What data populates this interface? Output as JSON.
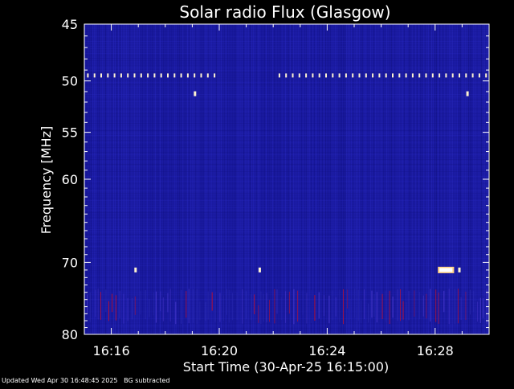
{
  "chart_data": {
    "type": "heatmap",
    "title": "Solar radio Flux (Glasgow)",
    "xlabel": "Start Time (30-Apr-25 16:15:00)",
    "ylabel": "Frequency [MHz]",
    "xlim_minutes_after_16_00": [
      15.0,
      30.0
    ],
    "ylim_mhz": [
      45,
      80
    ],
    "y_scale": "log",
    "x_ticks": [
      {
        "minute": 16,
        "label": "16:16"
      },
      {
        "minute": 20,
        "label": "16:20"
      },
      {
        "minute": 24,
        "label": "16:24"
      },
      {
        "minute": 28,
        "label": "16:28"
      }
    ],
    "y_ticks": [
      {
        "mhz": 45,
        "label": "45"
      },
      {
        "mhz": 50,
        "label": "50"
      },
      {
        "mhz": 55,
        "label": "55"
      },
      {
        "mhz": 60,
        "label": "60"
      },
      {
        "mhz": 70,
        "label": "70"
      },
      {
        "mhz": 80,
        "label": "80"
      }
    ],
    "colors": {
      "background": "#000000",
      "plot_base": "#1a1aa0",
      "interference_dots": "#fff3d0",
      "burst": "#ffffff",
      "noise_red": "#c01030"
    },
    "features": [
      {
        "name": "interference-line",
        "mhz": 49.5,
        "minute_ranges": [
          [
            15.1,
            19.9
          ],
          [
            22.2,
            29.9
          ]
        ]
      },
      {
        "name": "interference-spot",
        "mhz": 51.2,
        "minute": 19.1
      },
      {
        "name": "interference-spot",
        "mhz": 51.2,
        "minute": 29.2
      },
      {
        "name": "interference-spot",
        "mhz": 71.0,
        "minute": 16.9
      },
      {
        "name": "interference-spot",
        "mhz": 71.0,
        "minute": 21.5
      },
      {
        "name": "burst",
        "mhz": 71.0,
        "minute_range": [
          28.1,
          28.7
        ]
      },
      {
        "name": "interference-spot",
        "mhz": 71.0,
        "minute": 28.9
      },
      {
        "name": "noisy-band",
        "mhz_range": [
          73.5,
          78.5
        ]
      }
    ],
    "grid": false,
    "legend": "none"
  },
  "footer": {
    "text": "Updated Wed Apr 30 16:48:45 2025   BG subtracted"
  }
}
